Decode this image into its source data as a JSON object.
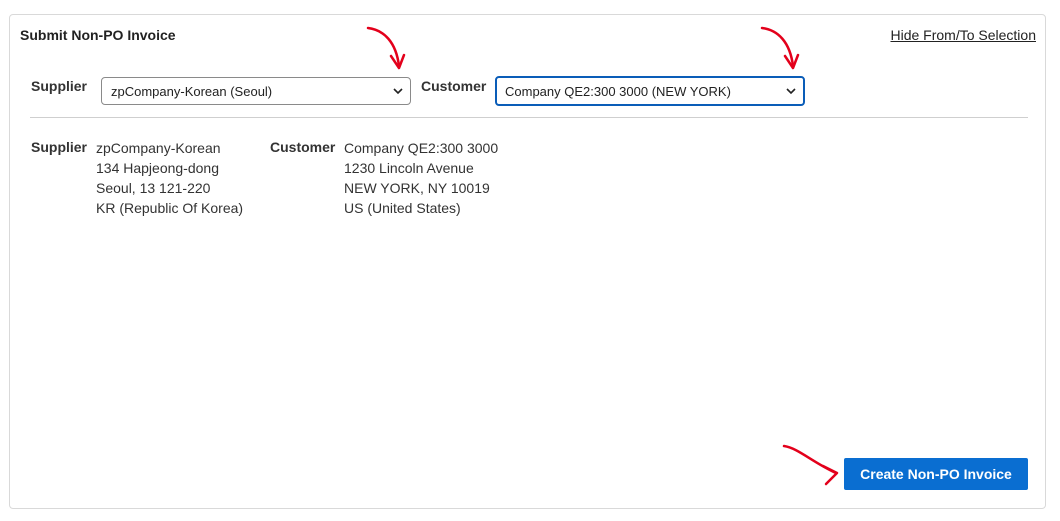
{
  "panel": {
    "title": "Submit Non-PO Invoice",
    "hide_link": "Hide From/To Selection"
  },
  "selection": {
    "supplier_label": "Supplier",
    "supplier_value": "zpCompany-Korean (Seoul)",
    "customer_label": "Customer",
    "customer_value": "Company QE2:300 3000 (NEW YORK)"
  },
  "addresses": {
    "supplier": {
      "label": "Supplier",
      "lines": [
        "zpCompany-Korean",
        "134 Hapjeong-dong",
        "Seoul, 13 121-220",
        "KR (Republic Of Korea)"
      ]
    },
    "customer": {
      "label": "Customer",
      "lines": [
        "Company QE2:300 3000",
        "1230 Lincoln Avenue",
        "NEW YORK, NY 10019",
        "US (United States)"
      ]
    }
  },
  "actions": {
    "create_label": "Create Non-PO Invoice"
  },
  "colors": {
    "primary_button": "#0a6ed1",
    "focus_border": "#0a5db8",
    "annotation_arrow": "#e3001b"
  },
  "icons": {
    "select_chevron": "chevron-down-icon",
    "annotation": "red-arrow-annotation"
  }
}
